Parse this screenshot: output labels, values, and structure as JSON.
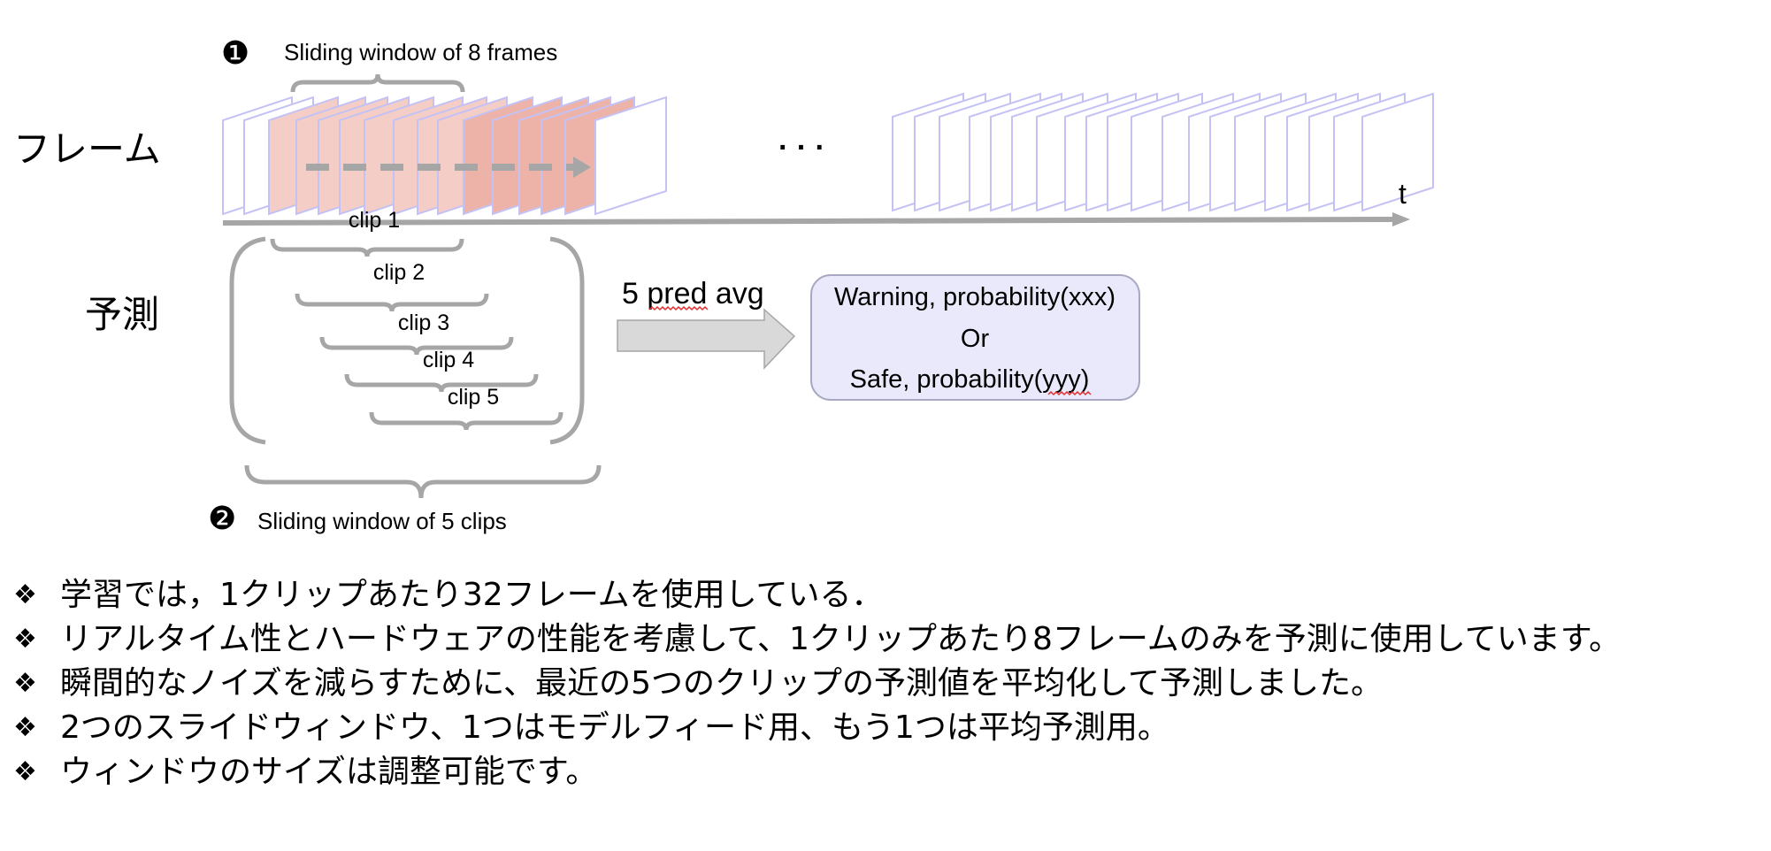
{
  "frames_label": "フレーム",
  "prediction_label": "予測",
  "window1": {
    "number": "❶",
    "label": "Sliding window of 8 frames"
  },
  "window2": {
    "number": "❷",
    "label": "Sliding window of 5 clips"
  },
  "ellipsis": "· · ·",
  "time_axis_label": "t",
  "clips": [
    "clip 1",
    "clip 2",
    "clip 3",
    "clip 4",
    "clip 5"
  ],
  "avg_label": "5 pred avg",
  "output_box": {
    "line1": "Warning, probability(xxx)",
    "line2": "Or",
    "line3": "Safe, probability(yyy)"
  },
  "colors": {
    "frame_stroke": "#c4c2f4",
    "frame_window": "#f4cdc6",
    "frame_window_dark": "#eeb3a8",
    "gray": "#a6a6a6",
    "box_fill": "#e9e9fb",
    "box_stroke": "#a8a8c4",
    "arrow_fill": "#d9d9d9"
  },
  "bullets": [
    "学習では，1クリップあたり32フレームを使用している．",
    "リアルタイム性とハードウェアの性能を考慮して、1クリップあたり8フレームのみを予測に使用しています。",
    "瞬間的なノイズを減らすために、最近の5つのクリップの予測値を平均化して予測しました。",
    "2つのスライドウィンドウ、1つはモデルフィード用、もう1つは平均予測用。",
    "ウィンドウのサイズは調整可能です。"
  ],
  "bullet_icon": "diamond-bullet-icon",
  "bullet_glyph": "❖"
}
